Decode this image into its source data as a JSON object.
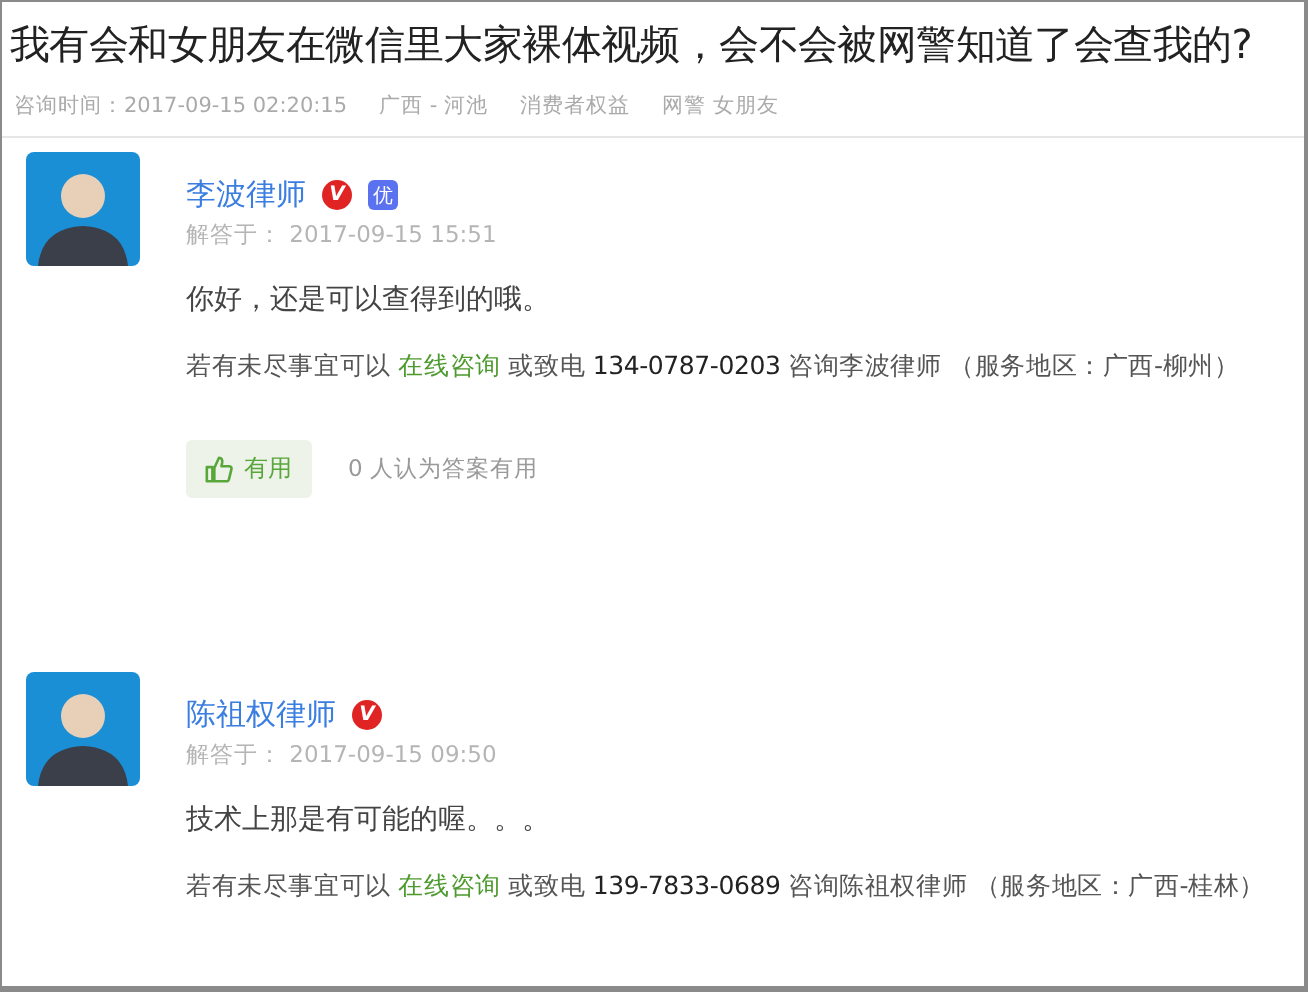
{
  "question": {
    "title": "我有会和女朋友在微信里大家裸体视频，会不会被网警知道了会查我的?",
    "meta": [
      "咨询时间：2017-09-15 02:20:15",
      "广西 - 河池",
      "消费者权益",
      "网警 女朋友"
    ]
  },
  "answers": [
    {
      "name": "李波律师",
      "badges": [
        {
          "kind": "verified",
          "text": "V"
        },
        {
          "kind": "excellent",
          "text": "优"
        }
      ],
      "time": "解答于：  2017-09-15 15:51",
      "text": "你好，还是可以查得到的哦。",
      "contact": {
        "prefix": "若有未尽事宜可以",
        "link": "在线咨询",
        "middle": "或致电",
        "phone": "134-0787-0203",
        "suffix": "咨询李波律师",
        "area": "（服务地区：广西-柳州）"
      },
      "useful": {
        "label": "有用",
        "count": "0 人认为答案有用"
      }
    },
    {
      "name": "陈祖权律师",
      "badges": [
        {
          "kind": "verified",
          "text": "V"
        }
      ],
      "time": "解答于：  2017-09-15 09:50",
      "text": "技术上那是有可能的喔。。。",
      "contact": {
        "prefix": "若有未尽事宜可以",
        "link": "在线咨询",
        "middle": "或致电",
        "phone": "139-7833-0689",
        "suffix": "咨询陈祖权律师",
        "area": "（服务地区：广西-桂林）"
      }
    }
  ]
}
